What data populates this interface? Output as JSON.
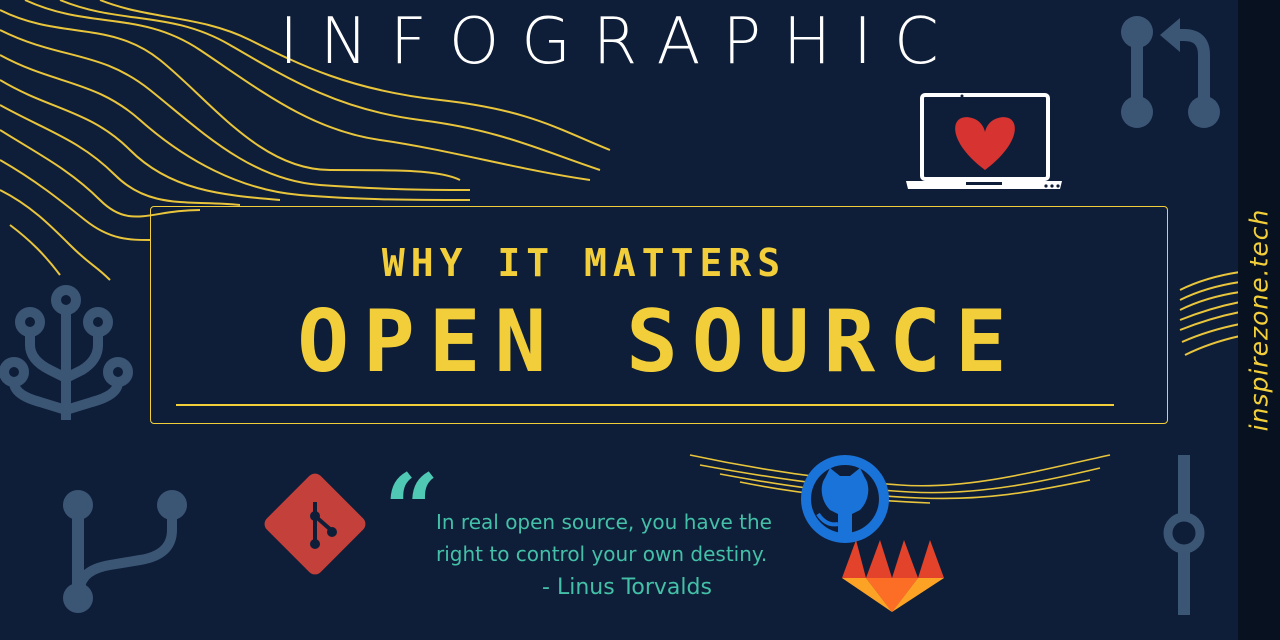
{
  "title": "INFOGRAPHIC",
  "banner": {
    "subtitle": "WHY IT MATTERS",
    "headline": "OPEN SOURCE"
  },
  "quote": {
    "line1": "In real open source, you have the",
    "line2": "right to control your own destiny.",
    "author": "- Linus Torvalds"
  },
  "site": "inspirezone.tech",
  "icons": [
    "pull-request-icon",
    "laptop-heart-icon",
    "circuit-tree-icon",
    "git-logo-icon",
    "github-logo-icon",
    "gitlab-logo-icon",
    "branch-icon",
    "commit-icon"
  ],
  "colors": {
    "background": "#0f1e38",
    "accent": "#f2cf3a",
    "quote": "#43c0a7",
    "muted_icon": "#3b5674",
    "git": "#c4403a",
    "github": "#1a73d9"
  }
}
